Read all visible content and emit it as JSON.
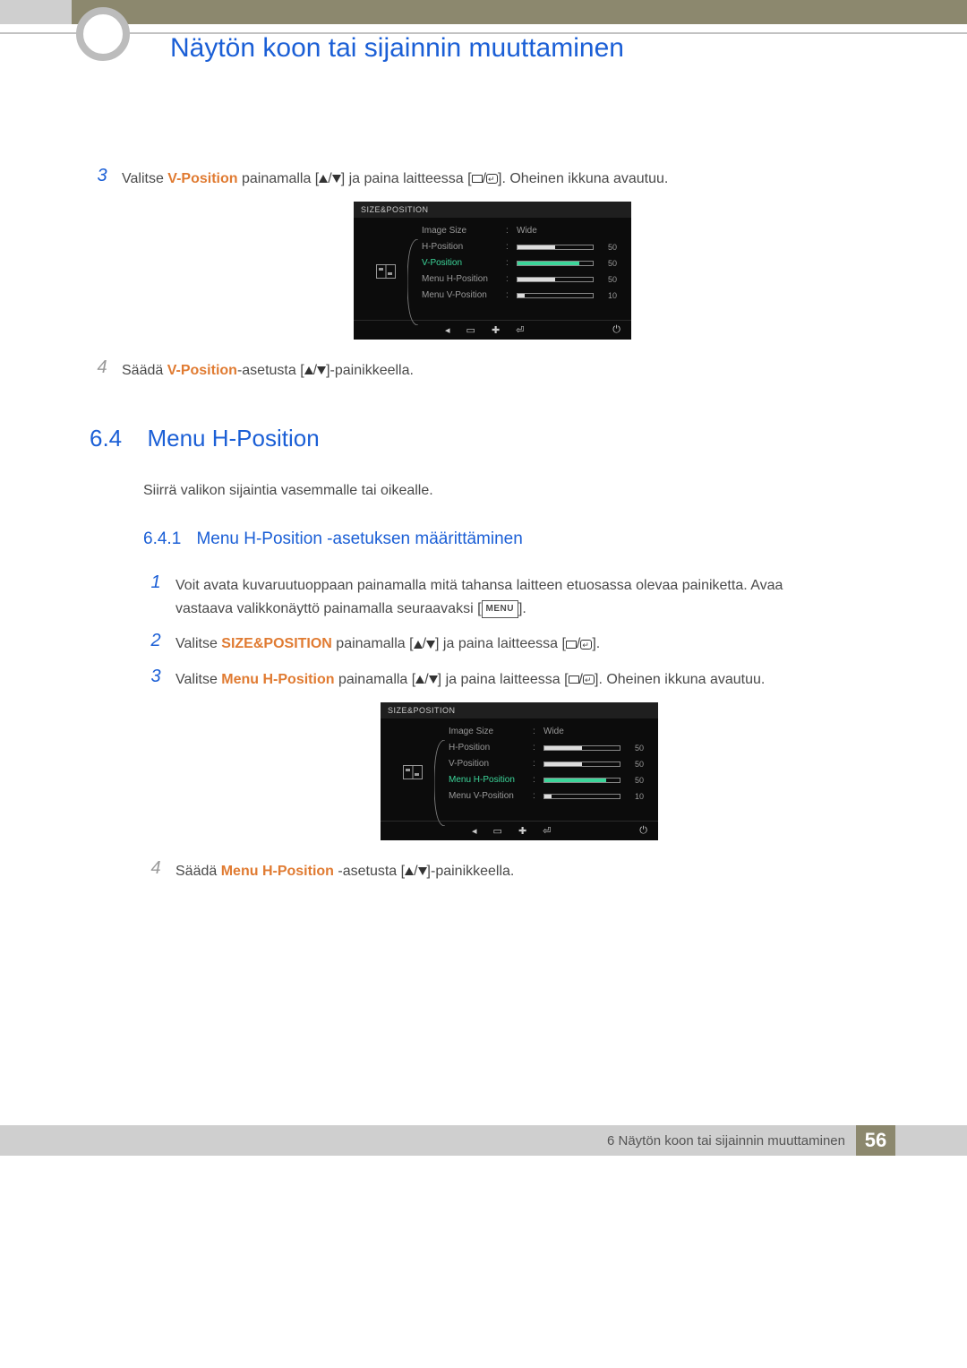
{
  "header": {
    "title": "Näytön koon tai sijainnin muuttaminen"
  },
  "step3_top": {
    "num": "3",
    "pre": "Valitse ",
    "term": "V-Position",
    "mid": " painamalla [",
    "mid2": "] ja paina laitteessa [",
    "post": "]. Oheinen ikkuna avautuu."
  },
  "osd1": {
    "title": "SIZE&POSITION",
    "rows": {
      "r0": {
        "label": "Image Size",
        "valtext": "Wide"
      },
      "r1": {
        "label": "H-Position",
        "val": "50",
        "pct": 50
      },
      "r2": {
        "label": "V-Position",
        "val": "50",
        "pct": 82
      },
      "r3": {
        "label": "Menu H-Position",
        "val": "50",
        "pct": 50
      },
      "r4": {
        "label": "Menu V-Position",
        "val": "10",
        "pct": 10
      }
    }
  },
  "step4_top": {
    "num": "4",
    "pre": "Säädä ",
    "term": "V-Position",
    "mid": "-asetusta [",
    "post": "]-painikkeella."
  },
  "section": {
    "num": "6.4",
    "title": "Menu H-Position",
    "desc": "Siirrä valikon sijaintia vasemmalle tai oikealle."
  },
  "subsection": {
    "num": "6.4.1",
    "title": "Menu H-Position -asetuksen määrittäminen"
  },
  "step1": {
    "num": "1",
    "line1": "Voit avata kuvaruutuoppaan painamalla mitä tahansa laitteen etuosassa olevaa painiketta. Avaa",
    "line2a": "vastaava valikkonäyttö painamalla seuraavaksi [",
    "menu": "MENU",
    "line2b": "]."
  },
  "step2": {
    "num": "2",
    "pre": "Valitse ",
    "term": "SIZE&POSITION",
    "mid": " painamalla [",
    "mid2": "] ja paina laitteessa [",
    "post": "]."
  },
  "step3b": {
    "num": "3",
    "pre": "Valitse ",
    "term": "Menu H-Position",
    "mid": " painamalla [",
    "mid2": "] ja paina laitteessa [",
    "post": "]. Oheinen ikkuna avautuu."
  },
  "osd2": {
    "title": "SIZE&POSITION",
    "rows": {
      "r0": {
        "label": "Image Size",
        "valtext": "Wide"
      },
      "r1": {
        "label": "H-Position",
        "val": "50",
        "pct": 50
      },
      "r2": {
        "label": "V-Position",
        "val": "50",
        "pct": 50
      },
      "r3": {
        "label": "Menu H-Position",
        "val": "50",
        "pct": 82
      },
      "r4": {
        "label": "Menu V-Position",
        "val": "10",
        "pct": 10
      }
    }
  },
  "step4b": {
    "num": "4",
    "pre": "Säädä ",
    "term": "Menu H-Position",
    "mid": " -asetusta [",
    "post": "]-painikkeella."
  },
  "footer": {
    "chapter": "6 Näytön koon tai sijainnin muuttaminen",
    "page": "56"
  }
}
